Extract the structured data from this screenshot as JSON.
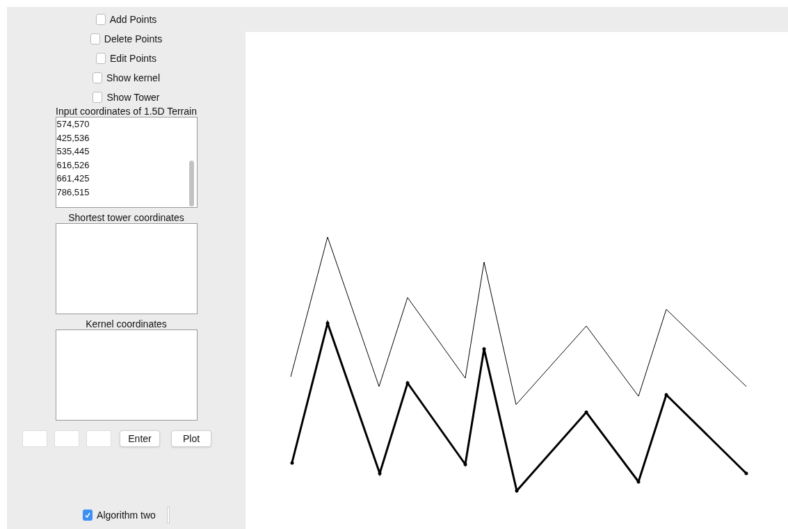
{
  "options": [
    {
      "label": "Add Points",
      "checked": false
    },
    {
      "label": "Delete Points",
      "checked": false
    },
    {
      "label": "Edit Points",
      "checked": false
    },
    {
      "label": "Show kernel",
      "checked": false
    },
    {
      "label": "Show Tower",
      "checked": false
    }
  ],
  "input_list": {
    "label": "Input coordinates of 1.5D Terrain",
    "lines": [
      "574,570",
      "425,536",
      "535,445",
      "616,526",
      "661,425",
      "786,515"
    ]
  },
  "tower_list": {
    "label": "Shortest tower coordinates"
  },
  "kernel_list": {
    "label": "Kernel coordinates"
  },
  "buttons": [
    "Enter",
    "Plot"
  ],
  "algorithm": {
    "label": "Algorithm two",
    "checked": true
  }
}
